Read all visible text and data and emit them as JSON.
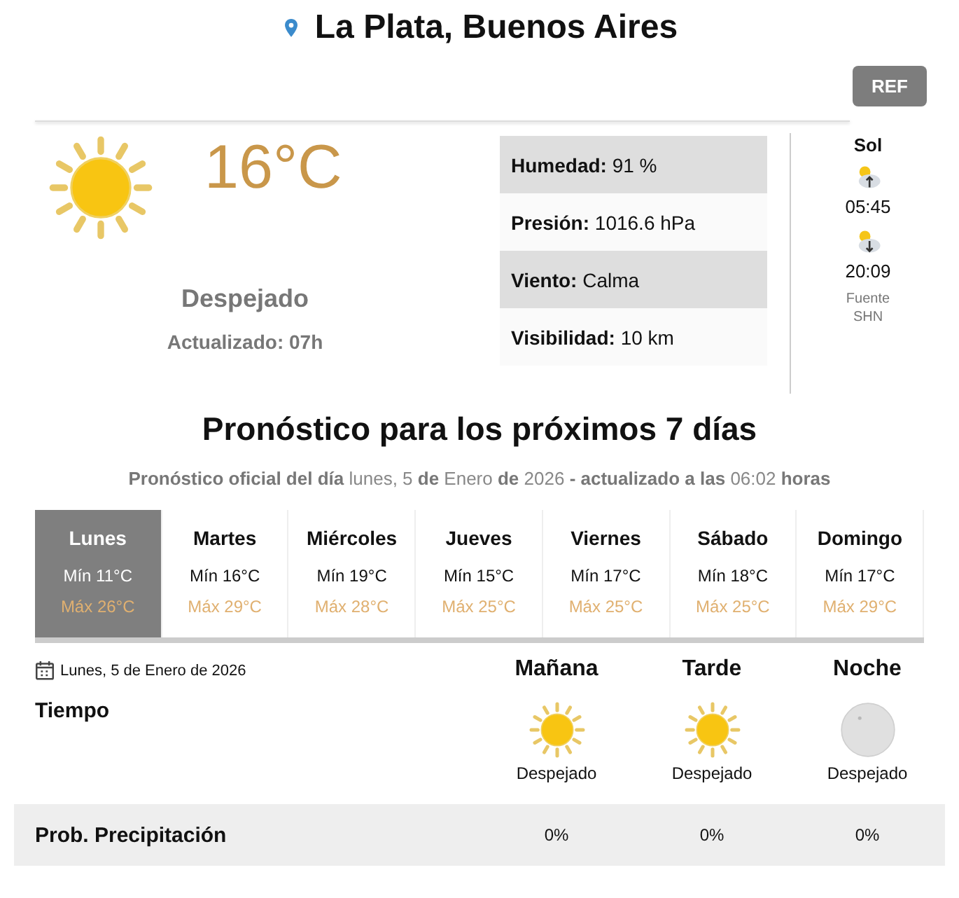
{
  "location": "La Plata, Buenos Aires",
  "refresh_button": "REF",
  "current": {
    "kind": "sun",
    "temperature": "16°C",
    "condition": "Despejado",
    "updated": "Actualizado: 07h"
  },
  "details": [
    {
      "label": "Humedad:",
      "value": "91 %"
    },
    {
      "label": "Presión:",
      "value": "1016.6 hPa"
    },
    {
      "label": "Viento:",
      "value": "Calma"
    },
    {
      "label": "Visibilidad:",
      "value": "10 km"
    }
  ],
  "sun": {
    "title": "Sol",
    "sunrise": "05:45",
    "sunset": "20:09",
    "source": "Fuente",
    "source_name": "SHN"
  },
  "forecast": {
    "title": "Pronóstico para los próximos 7 días",
    "subtitle": "**Pronóstico oficial del día** lunes, 5 **de** Enero **de** 2026 **- actualizado a las** 06:02 **horas**",
    "days": [
      {
        "name": "Lunes",
        "min": "Mín 11°C",
        "max": "Máx 26°C",
        "selected": true
      },
      {
        "name": "Martes",
        "min": "Mín 16°C",
        "max": "Máx 29°C",
        "selected": false
      },
      {
        "name": "Miércoles",
        "min": "Mín 19°C",
        "max": "Máx 28°C",
        "selected": false
      },
      {
        "name": "Jueves",
        "min": "Mín 15°C",
        "max": "Máx 25°C",
        "selected": false
      },
      {
        "name": "Viernes",
        "min": "Mín 17°C",
        "max": "Máx 25°C",
        "selected": false
      },
      {
        "name": "Sábado",
        "min": "Mín 18°C",
        "max": "Máx 25°C",
        "selected": false
      },
      {
        "name": "Domingo",
        "min": "Mín 17°C",
        "max": "Máx 29°C",
        "selected": false
      }
    ]
  },
  "day_detail": {
    "date": "Lunes, 5 de Enero de 2026",
    "weather_label": "Tiempo",
    "precipitation_label": "Prob. Precipitación",
    "periods": [
      {
        "name": "Mañana",
        "kind": "sun",
        "condition": "Despejado",
        "precipitation": "0%"
      },
      {
        "name": "Tarde",
        "kind": "sun",
        "condition": "Despejado",
        "precipitation": "0%"
      },
      {
        "name": "Noche",
        "kind": "moon",
        "condition": "Despejado",
        "precipitation": "0%"
      }
    ]
  }
}
